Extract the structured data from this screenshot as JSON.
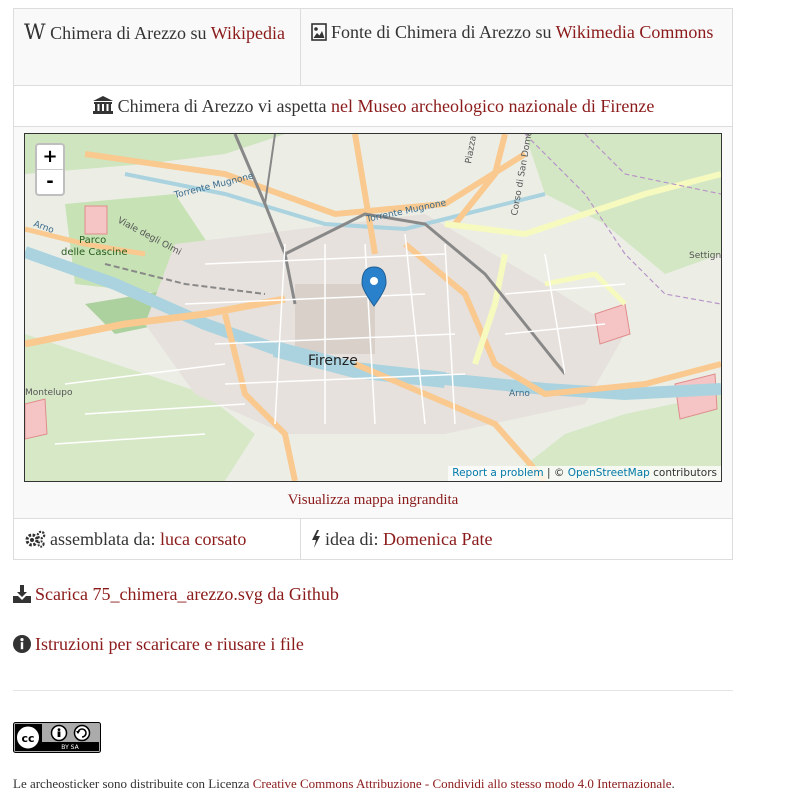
{
  "header": {
    "wikipedia_prefix": "Chimera di Arezzo su",
    "wikipedia_link": "Wikipedia",
    "commons_prefix": "Fonte di Chimera di Arezzo su",
    "commons_link": "Wikimedia Commons"
  },
  "museum": {
    "prefix": "Chimera di Arezzo vi aspetta",
    "link": "nel Museo archeologico nazionale di Firenze"
  },
  "map": {
    "zoom_in": "+",
    "zoom_out": "-",
    "report": "Report a problem",
    "separator": " | © ",
    "osm": "OpenStreetMap",
    "contributors": " contributors",
    "labels": {
      "city": "Firenze",
      "parco": "Parco",
      "cascine": "delle Cascine",
      "torrente1": "Torrente Mugnone",
      "torrente2": "Torrente Mugnone",
      "arno_left": "Arno",
      "arno_right": "Arno",
      "viale": "Viale degli Olmi",
      "corso": "Corso di San Domenico",
      "piazza": "Piazza",
      "montelupo": "Montelupo",
      "settign": "Settign"
    },
    "enlarge_link": "Visualizza mappa ingrandita"
  },
  "credits": {
    "assembled_label": "assemblata da:",
    "assembled_name": "luca corsato",
    "idea_label": "idea di:",
    "idea_name": "Domenica Pate"
  },
  "download_link": "Scarica 75_chimera_arezzo.svg da Github",
  "instructions_link": "Istruzioni per scaricare e riusare i file",
  "license": {
    "badge_text": "BY SA",
    "prefix": "Le archeosticker sono distribuite con Licenza",
    "link": "Creative Commons Attribuzione - Condividi allo stesso modo 4.0 Internazionale",
    "suffix": "."
  },
  "colors": {
    "link": "#8b1a1a",
    "marker": "#2a81cb",
    "river": "#aad3df",
    "major_road": "#f9c98f",
    "secondary_road": "#f7fabf"
  },
  "icons": [
    "wikipedia-icon",
    "image-icon",
    "museum-icon",
    "cogs-icon",
    "bolt-icon",
    "download-icon",
    "info-icon",
    "marker-icon"
  ]
}
